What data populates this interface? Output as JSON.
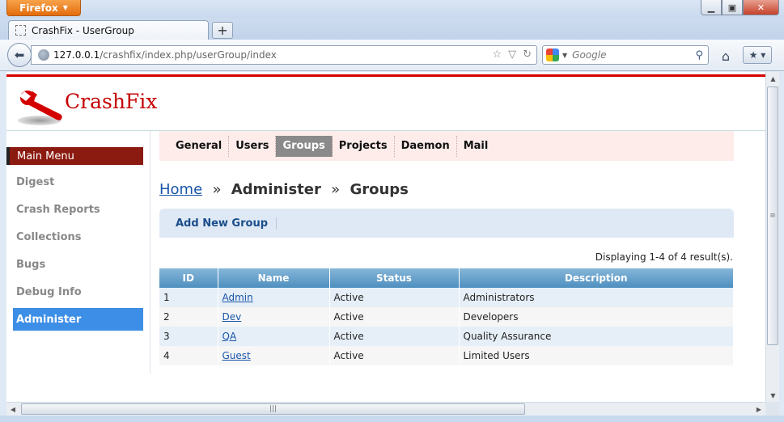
{
  "browser": {
    "app_button": "Firefox",
    "tab_title": "CrashFix - UserGroup",
    "url_host": "127.0.0.1",
    "url_path": "/crashfix/index.php/userGroup/index",
    "search_placeholder": "Google"
  },
  "site": {
    "brand": "CrashFix"
  },
  "sidebar": {
    "title": "Main Menu",
    "items": [
      {
        "label": "Digest"
      },
      {
        "label": "Crash Reports"
      },
      {
        "label": "Collections"
      },
      {
        "label": "Bugs"
      },
      {
        "label": "Debug Info"
      },
      {
        "label": "Administer",
        "active": true
      }
    ]
  },
  "topmenu": {
    "items": [
      {
        "label": "General"
      },
      {
        "label": "Users"
      },
      {
        "label": "Groups",
        "selected": true
      },
      {
        "label": "Projects"
      },
      {
        "label": "Daemon"
      },
      {
        "label": "Mail"
      }
    ]
  },
  "breadcrumb": {
    "home": "Home",
    "separator": "»",
    "middle": "Administer",
    "current": "Groups"
  },
  "actions": {
    "add_group": "Add New Group"
  },
  "grid": {
    "summary": "Displaying 1-4 of 4 result(s).",
    "columns": [
      "ID",
      "Name",
      "Status",
      "Description"
    ],
    "rows": [
      {
        "id": "1",
        "name": "Admin",
        "status": "Active",
        "description": "Administrators"
      },
      {
        "id": "2",
        "name": "Dev",
        "status": "Active",
        "description": "Developers"
      },
      {
        "id": "3",
        "name": "QA",
        "status": "Active",
        "description": "Quality Assurance"
      },
      {
        "id": "4",
        "name": "Guest",
        "status": "Active",
        "description": "Limited Users"
      }
    ]
  },
  "colors": {
    "brand_red": "#c60000",
    "menu_title_bg": "#8b1a10",
    "active_item_bg": "#3d8ee6",
    "grid_header": "#5e9ac8",
    "link": "#1a55a8"
  },
  "icons": [
    "firefox-caret-icon",
    "minimize-icon",
    "maximize-icon",
    "close-icon",
    "favicon-icon",
    "new-tab-icon",
    "back-icon",
    "globe-icon",
    "star-icon",
    "history-caret-icon",
    "reload-icon",
    "google-icon",
    "search-icon",
    "home-icon",
    "bookmarks-icon",
    "wrench-logo-icon"
  ]
}
